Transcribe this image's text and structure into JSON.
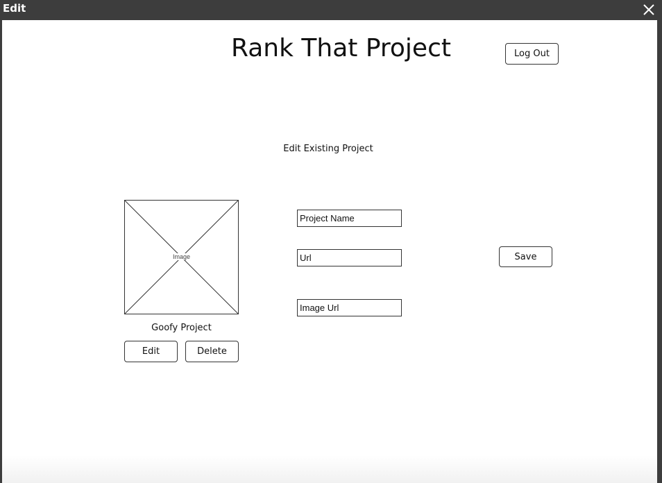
{
  "window": {
    "title": "Edit"
  },
  "header": {
    "app_title": "Rank That Project",
    "logout_label": "Log Out"
  },
  "main": {
    "section_label": "Edit Existing Project",
    "project_card": {
      "image_placeholder": "Image",
      "caption": "Goofy Project",
      "edit_label": "Edit",
      "delete_label": "Delete"
    },
    "form": {
      "project_name_placeholder": "Project Name",
      "url_placeholder": "Url",
      "image_url_placeholder": "Image Url",
      "save_label": "Save"
    }
  },
  "colors": {
    "titlebar": "#3d3d3d",
    "canvas": "#ffffff",
    "border": "#333333"
  },
  "icons": {
    "close": "close-icon"
  }
}
